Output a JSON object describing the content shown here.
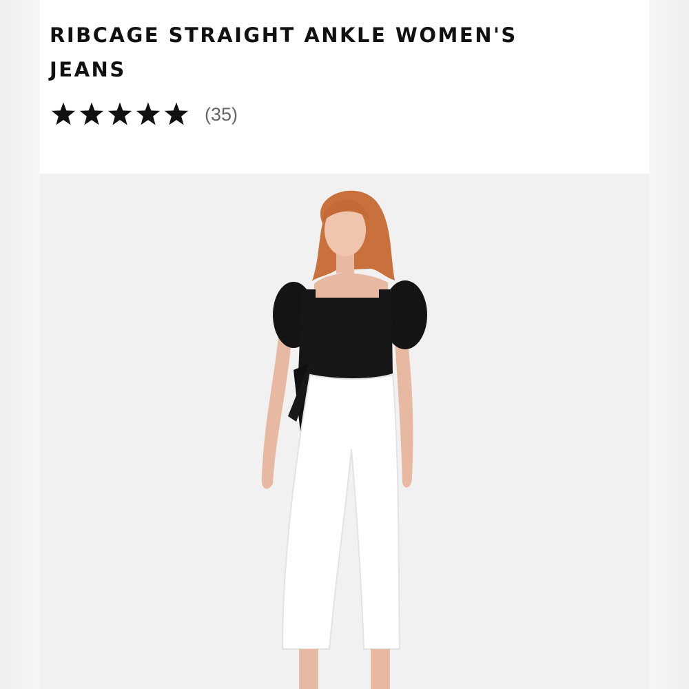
{
  "product": {
    "title": "RIBCAGE STRAIGHT ANKLE WOMEN'S JEANS",
    "rating": {
      "stars": 5,
      "max_stars": 5,
      "review_count_label": "(35)"
    }
  },
  "image": {
    "subject": "model-wearing-black-puff-sleeve-top-and-white-cropped-jeans"
  },
  "colors": {
    "title": "#111111",
    "star": "#111111",
    "count": "#666666",
    "photo_background": "#f1f1f1"
  }
}
